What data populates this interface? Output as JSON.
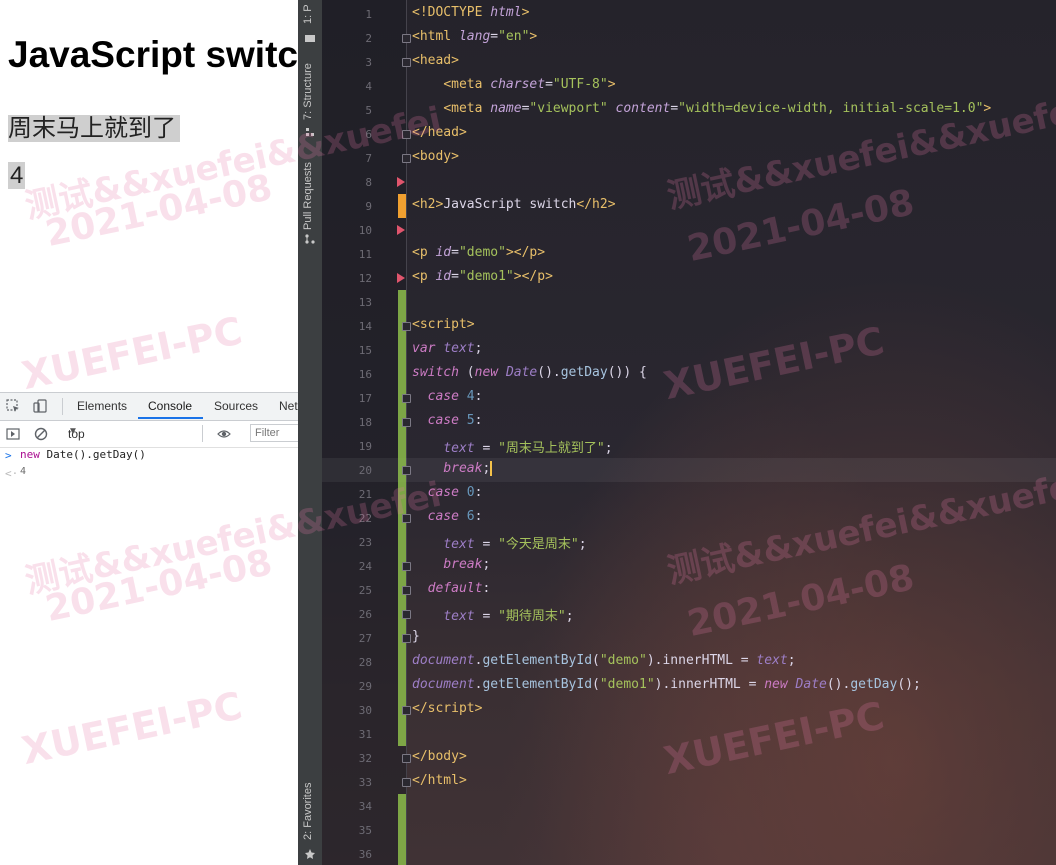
{
  "browser": {
    "heading": "JavaScript switc",
    "demo_text": "周末马上就到了",
    "demo1_text": "4"
  },
  "devtools": {
    "tabs": [
      "Elements",
      "Console",
      "Sources",
      "Net"
    ],
    "active_tab": "Console",
    "context": "top",
    "filter_placeholder": "Filter",
    "console_input_kw": "new",
    "console_input_rest": " Date().getDay()",
    "console_output": "4"
  },
  "ide": {
    "side_tabs": [
      "1: P",
      "7: Structure",
      "Pull Requests",
      "2: Favorites"
    ],
    "current_line": 20
  },
  "code_lines": [
    {
      "n": 1,
      "html": "<span class=\"t-br\">&lt;!DOCTYPE </span><span class=\"t-attr\">html</span><span class=\"t-br\">&gt;</span>"
    },
    {
      "n": 2,
      "html": "<span class=\"t-br\">&lt;</span><span class=\"t-tag\">html </span><span class=\"t-attr\">lang</span><span class=\"t-txt\">=</span><span class=\"t-str\">\"en\"</span><span class=\"t-br\">&gt;</span>"
    },
    {
      "n": 3,
      "html": "<span class=\"t-br\">&lt;</span><span class=\"t-tag\">head</span><span class=\"t-br\">&gt;</span>"
    },
    {
      "n": 4,
      "html": "    <span class=\"t-br\">&lt;</span><span class=\"t-tag\">meta </span><span class=\"t-attr\">charset</span><span class=\"t-txt\">=</span><span class=\"t-str\">\"UTF-8\"</span><span class=\"t-br\">&gt;</span>"
    },
    {
      "n": 5,
      "html": "    <span class=\"t-br\">&lt;</span><span class=\"t-tag\">meta </span><span class=\"t-attr\">name</span><span class=\"t-txt\">=</span><span class=\"t-str\">\"viewport\"</span> <span class=\"t-attr\">content</span><span class=\"t-txt\">=</span><span class=\"t-str\">\"width=device-width, initial-scale=1.0\"</span><span class=\"t-br\">&gt;</span>"
    },
    {
      "n": 6,
      "html": "<span class=\"t-br\">&lt;/</span><span class=\"t-tag\">head</span><span class=\"t-br\">&gt;</span>"
    },
    {
      "n": 7,
      "html": "<span class=\"t-br\">&lt;</span><span class=\"t-tag\">body</span><span class=\"t-br\">&gt;</span>"
    },
    {
      "n": 8,
      "html": ""
    },
    {
      "n": 9,
      "html": "<span class=\"t-br\">&lt;</span><span class=\"t-tag\">h2</span><span class=\"t-br\">&gt;</span><span class=\"t-txt\">JavaScript switch</span><span class=\"t-br\">&lt;/</span><span class=\"t-tag\">h2</span><span class=\"t-br\">&gt;</span>"
    },
    {
      "n": 10,
      "html": ""
    },
    {
      "n": 11,
      "html": "<span class=\"t-br\">&lt;</span><span class=\"t-tag\">p </span><span class=\"t-attr\">id</span><span class=\"t-txt\">=</span><span class=\"t-str\">\"demo\"</span><span class=\"t-br\">&gt;&lt;/</span><span class=\"t-tag\">p</span><span class=\"t-br\">&gt;</span>"
    },
    {
      "n": 12,
      "html": "<span class=\"t-br\">&lt;</span><span class=\"t-tag\">p </span><span class=\"t-attr\">id</span><span class=\"t-txt\">=</span><span class=\"t-str\">\"demo1\"</span><span class=\"t-br\">&gt;&lt;/</span><span class=\"t-tag\">p</span><span class=\"t-br\">&gt;</span>"
    },
    {
      "n": 13,
      "html": ""
    },
    {
      "n": 14,
      "html": "<span class=\"t-br\">&lt;</span><span class=\"t-tag\">script</span><span class=\"t-br\">&gt;</span>"
    },
    {
      "n": 15,
      "html": "<span class=\"t-kwi\">var</span> <span class=\"t-var\">text</span><span class=\"t-txt\">;</span>"
    },
    {
      "n": 16,
      "html": "<span class=\"t-kwi\">switch</span> <span class=\"t-txt\">(</span><span class=\"t-kwi\">new</span> <span class=\"t-var\">Date</span><span class=\"t-txt\">().</span><span class=\"t-fn\">getDay</span><span class=\"t-txt\">()) {</span>"
    },
    {
      "n": 17,
      "html": "  <span class=\"t-kwi\">case</span> <span class=\"t-num\">4</span><span class=\"t-txt\">:</span>"
    },
    {
      "n": 18,
      "html": "  <span class=\"t-kwi\">case</span> <span class=\"t-num\">5</span><span class=\"t-txt\">:</span>"
    },
    {
      "n": 19,
      "html": "    <span class=\"t-var\">text</span> <span class=\"t-txt\">=</span> <span class=\"t-str\">\"周末马上就到了\"</span><span class=\"t-txt\">;</span>"
    },
    {
      "n": 20,
      "html": "    <span class=\"t-kwi\">break</span><span class=\"t-txt\">;</span>"
    },
    {
      "n": 21,
      "html": "  <span class=\"t-kwi\">case</span> <span class=\"t-num\">0</span><span class=\"t-txt\">:</span>"
    },
    {
      "n": 22,
      "html": "  <span class=\"t-kwi\">case</span> <span class=\"t-num\">6</span><span class=\"t-txt\">:</span>"
    },
    {
      "n": 23,
      "html": "    <span class=\"t-var\">text</span> <span class=\"t-txt\">=</span> <span class=\"t-str\">\"今天是周末\"</span><span class=\"t-txt\">;</span>"
    },
    {
      "n": 24,
      "html": "    <span class=\"t-kwi\">break</span><span class=\"t-txt\">;</span>"
    },
    {
      "n": 25,
      "html": "  <span class=\"t-kwi\">default</span><span class=\"t-txt\">:</span>"
    },
    {
      "n": 26,
      "html": "    <span class=\"t-var\">text</span> <span class=\"t-txt\">=</span> <span class=\"t-str\">\"期待周末\"</span><span class=\"t-txt\">;</span>"
    },
    {
      "n": 27,
      "html": "<span class=\"t-txt\">}</span>"
    },
    {
      "n": 28,
      "html": "<span class=\"t-var\">document</span><span class=\"t-txt\">.</span><span class=\"t-fn\">getElementById</span><span class=\"t-txt\">(</span><span class=\"t-str\">\"demo\"</span><span class=\"t-txt\">).innerHTML = </span><span class=\"t-var\">text</span><span class=\"t-txt\">;</span>"
    },
    {
      "n": 29,
      "html": "<span class=\"t-var\">document</span><span class=\"t-txt\">.</span><span class=\"t-fn\">getElementById</span><span class=\"t-txt\">(</span><span class=\"t-str\">\"demo1\"</span><span class=\"t-txt\">).innerHTML = </span><span class=\"t-kwi\">new</span> <span class=\"t-var\">Date</span><span class=\"t-txt\">().</span><span class=\"t-fn\">getDay</span><span class=\"t-txt\">();</span>"
    },
    {
      "n": 30,
      "html": "<span class=\"t-br\">&lt;/</span><span class=\"t-tag\">script</span><span class=\"t-br\">&gt;</span>"
    },
    {
      "n": 31,
      "html": ""
    },
    {
      "n": 32,
      "html": "<span class=\"t-br\">&lt;/</span><span class=\"t-tag\">body</span><span class=\"t-br\">&gt;</span>"
    },
    {
      "n": 33,
      "html": "<span class=\"t-br\">&lt;/</span><span class=\"t-tag\">html</span><span class=\"t-br\">&gt;</span>"
    },
    {
      "n": 34,
      "html": ""
    },
    {
      "n": 35,
      "html": ""
    },
    {
      "n": 36,
      "html": ""
    }
  ],
  "watermark": {
    "line1": "测试&&xuefei&&xuefei",
    "line2": "2021-04-08",
    "line3": "XUEFEI-PC"
  },
  "colors": {
    "vcs_added": "#8dbd4b",
    "breakpoint_marker": "#e0556d",
    "bookmark_marker": "#f0a030",
    "link_blue": "#1a73e8"
  }
}
